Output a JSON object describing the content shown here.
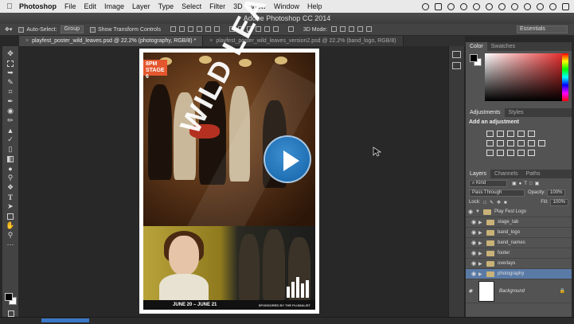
{
  "menubar": {
    "apple": "",
    "app": "Photoshop",
    "items": [
      "File",
      "Edit",
      "Image",
      "Layer",
      "Type",
      "Select",
      "Filter",
      "3D",
      "View",
      "Window",
      "Help"
    ]
  },
  "window": {
    "title": "Adobe Photoshop CC 2014"
  },
  "options": {
    "auto_select": "Auto-Select:",
    "group": "Group",
    "show_transform": "Show Transform Controls",
    "mode3d": "3D Mode:",
    "workspace": "Essentials"
  },
  "doc_tabs": [
    {
      "label": "playfest_poster_wild_leaves.psd @ 22.2% (photography, RGB/8) *",
      "active": true
    },
    {
      "label": "playfest_poster_wild_leaves_version2.psd @ 22.2% (band_logo, RGB/8)",
      "active": false
    }
  ],
  "poster": {
    "stage_tab": [
      "8PM",
      "STAGE 6"
    ],
    "band": "WILD LEAVES",
    "dates": "JUNE 20 – JUNE 21",
    "sponsor": "SPONSORED BY THE PLUMALIST"
  },
  "panels": {
    "color_tabs": [
      "Color",
      "Swatches"
    ],
    "adj_tabs": [
      "Adjustments",
      "Styles"
    ],
    "adj_title": "Add an adjustment",
    "layer_tabs": [
      "Layers",
      "Channels",
      "Paths"
    ],
    "kind": "Kind",
    "blend_mode": "Pass Through",
    "opacity_label": "Opacity:",
    "opacity": "100%",
    "lock_label": "Lock:",
    "fill_label": "Fill:",
    "fill": "100%",
    "layers": [
      {
        "name": "Play Fest Logo",
        "expanded": true,
        "sub": false,
        "selected": false
      },
      {
        "name": "stage_tab",
        "expanded": false,
        "sub": true,
        "selected": false
      },
      {
        "name": "band_logo",
        "expanded": false,
        "sub": true,
        "selected": false
      },
      {
        "name": "band_names",
        "expanded": false,
        "sub": true,
        "selected": false
      },
      {
        "name": "footer",
        "expanded": false,
        "sub": true,
        "selected": false
      },
      {
        "name": "overlays",
        "expanded": false,
        "sub": true,
        "selected": false
      },
      {
        "name": "photography",
        "expanded": false,
        "sub": true,
        "selected": true
      }
    ],
    "background_layer": "Background"
  },
  "colors": {
    "accent_orange": "#e4572e",
    "play_blue": "#1f6fb4",
    "selected_layer": "#5a7aa6"
  }
}
